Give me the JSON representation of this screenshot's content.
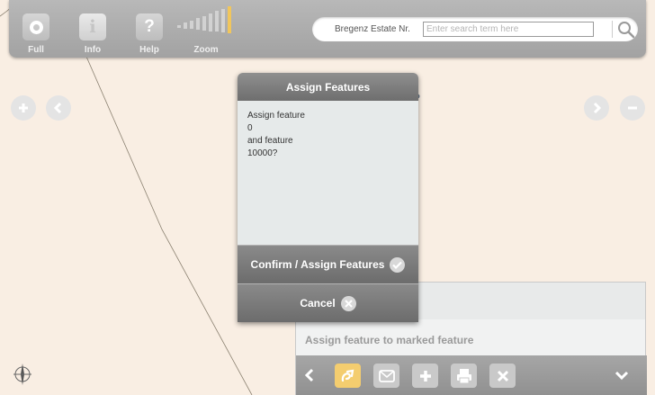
{
  "toolbar": {
    "full_label": "Full",
    "info_label": "Info",
    "info_glyph": "i",
    "help_label": "Help",
    "help_glyph": "?",
    "zoom_label": "Zoom",
    "zoom_level": 8
  },
  "search": {
    "scope": "Bregenz Estate Nr.",
    "placeholder": "Enter search term here"
  },
  "dialog": {
    "title": "Assign Features",
    "message_lines": [
      "Assign feature",
      "0",
      "and feature",
      "10000?"
    ],
    "confirm_label": "Confirm / Assign Features",
    "cancel_label": "Cancel"
  },
  "panel": {
    "hint": "Assign feature to marked feature"
  },
  "colors": {
    "map_background": "#f9eee3",
    "active_tool": "#f4cd6f",
    "zoom_active": "#f1c65c"
  },
  "icons": [
    "zoom-full-icon",
    "info-icon",
    "help-icon",
    "search-icon",
    "plus-icon",
    "chevron-left-icon",
    "chevron-right-icon",
    "minus-icon",
    "north-arrow-icon",
    "check-icon",
    "close-icon",
    "assign-link-icon",
    "mail-icon",
    "add-icon",
    "print-icon",
    "delete-icon",
    "chevron-down-icon"
  ]
}
